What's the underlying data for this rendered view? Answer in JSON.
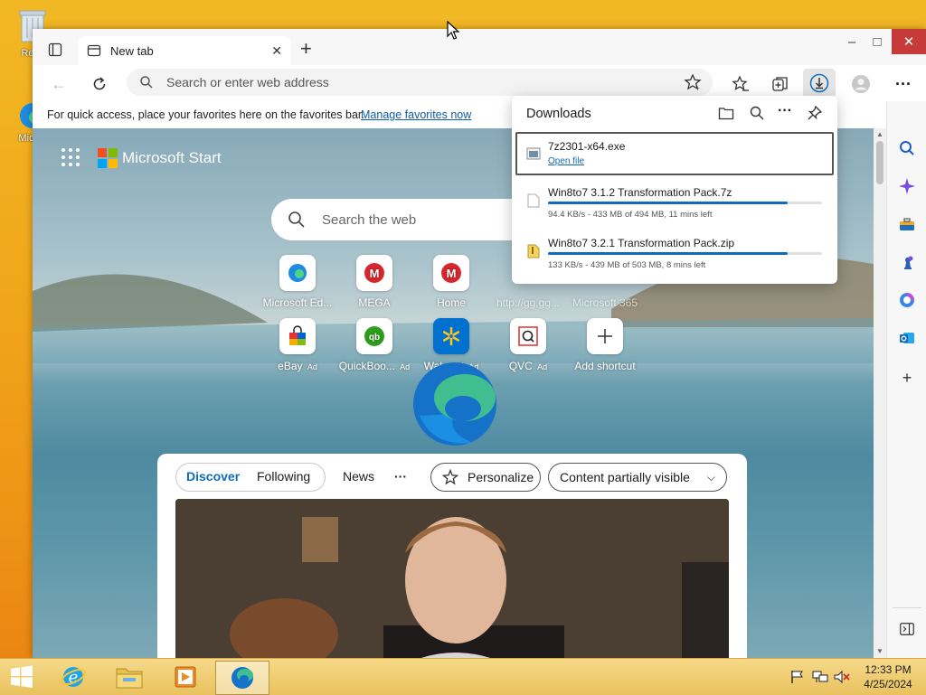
{
  "desktop": {
    "recycle_bin_label": "Recy",
    "edge_label": "Micr E"
  },
  "window": {
    "tab_title": "New tab",
    "controls": {
      "minimize": "–",
      "maximize": "□",
      "close": "✕"
    }
  },
  "toolbar": {
    "address_placeholder": "Search or enter web address"
  },
  "favorites_bar": {
    "message": "For quick access, place your favorites here on the favorites bar.",
    "link": "Manage favorites now"
  },
  "new_tab_page": {
    "brand": "Microsoft Start",
    "search_placeholder": "Search the web",
    "shortcuts_row1": [
      {
        "label": "Microsoft Ed...",
        "ad": ""
      },
      {
        "label": "MEGA",
        "ad": ""
      },
      {
        "label": "Home",
        "ad": ""
      },
      {
        "label": "http://gg.gg...",
        "ad": ""
      },
      {
        "label": "Microsoft 365",
        "ad": ""
      }
    ],
    "shortcuts_row2": [
      {
        "label": "eBay",
        "ad": "Ad"
      },
      {
        "label": "QuickBoo...",
        "ad": "Ad"
      },
      {
        "label": "Walmart",
        "ad": "Ad"
      },
      {
        "label": "QVC",
        "ad": "Ad"
      },
      {
        "label": "Add shortcut",
        "ad": ""
      }
    ]
  },
  "feed": {
    "tabs": [
      "Discover",
      "Following"
    ],
    "news": "News",
    "more": "···",
    "personalize": "Personalize",
    "visibility": "Content partially visible"
  },
  "downloads": {
    "title": "Downloads",
    "items": [
      {
        "name": "7z2301-x64.exe",
        "action": "Open file"
      },
      {
        "name": "Win8to7 3.1.2 Transformation Pack.7z",
        "status": "94.4 KB/s - 433 MB of 494 MB, 11 mins left",
        "progress": 0.876
      },
      {
        "name": "Win8to7 3.2.1 Transformation Pack.zip",
        "status": "133 KB/s - 439 MB of 503 MB, 8 mins left",
        "progress": 0.873
      }
    ]
  },
  "taskbar": {
    "time": "12:33 PM",
    "date": "4/25/2024"
  },
  "colors": {
    "accent": "#0f6cbd",
    "taskbar": "#f0c65a",
    "desktop": "#f0a81b"
  }
}
